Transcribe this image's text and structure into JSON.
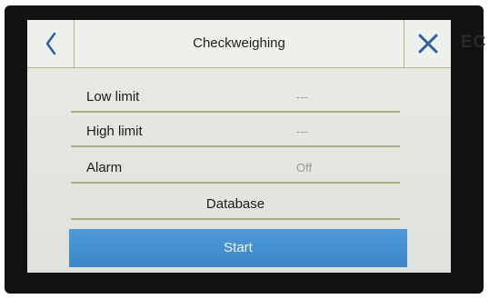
{
  "header": {
    "title": "Checkweighing",
    "back_icon": "chevron-left-icon",
    "close_icon": "close-x-icon"
  },
  "settings": [
    {
      "label": "Low limit",
      "value": "---"
    },
    {
      "label": "High limit",
      "value": "---"
    },
    {
      "label": "Alarm",
      "value": "Off"
    }
  ],
  "database_label": "Database",
  "start_label": "Start",
  "brand_fragment": "EC",
  "colors": {
    "accent_blue": "#3f8acb",
    "divider_olive": "#a9ad7f",
    "icon_blue": "#2b5fa3",
    "screen_bg": "#e6e8e4"
  }
}
